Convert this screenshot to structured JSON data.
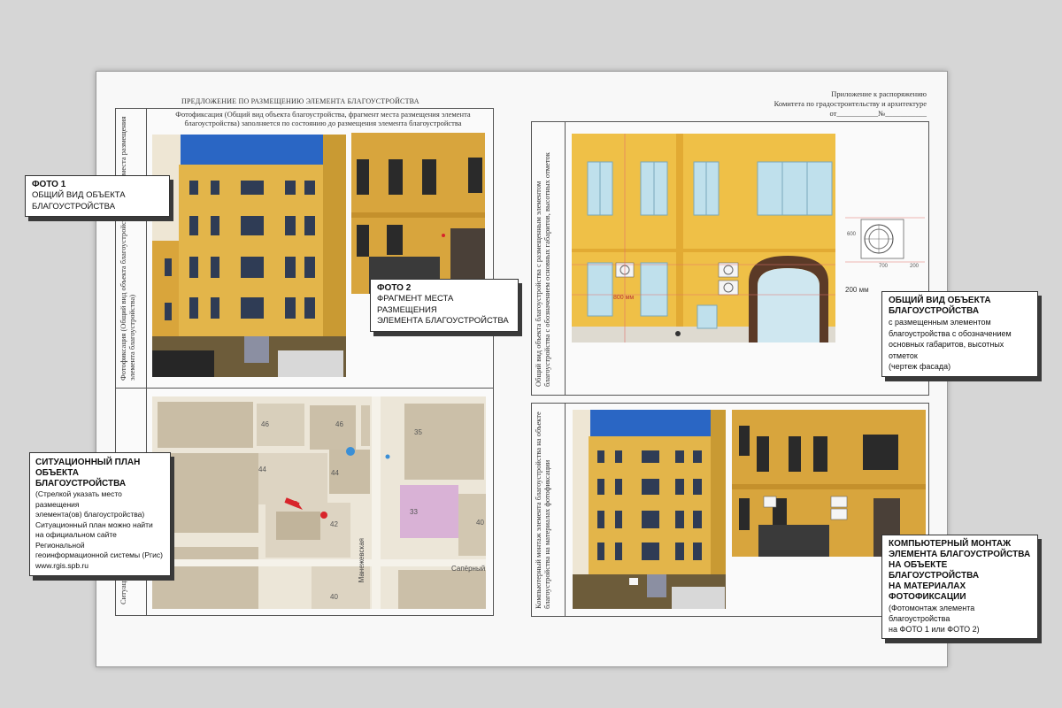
{
  "header": {
    "title": "ПРЕДЛОЖЕНИЕ ПО РАЗМЕЩЕНИЮ ЭЛЕМЕНТА БЛАГОУСТРОЙСТВА",
    "appendix_line1": "Приложение к распоряжению",
    "appendix_line2": "Комитета по градостроительству и архитектуре",
    "appendix_line3": "от___________№___________"
  },
  "photo_panel": {
    "side_label": "Фотофиксация (Общий вид объекта благоустройства, фрагмент места размещения элемента благоустройства)",
    "caption": "Фотофиксация (Общий вид объекта благоустройства, фрагмент места размещения элемента благоустройства) заполняется по состоянию до размещения элемента благоустройства"
  },
  "plan_panel": {
    "side_label": "Ситуационный план объекта благоустройства",
    "streets": [
      "Манежевская",
      "Сапёрный"
    ],
    "house_numbers": [
      "46",
      "46",
      "44",
      "44",
      "42",
      "40",
      "35",
      "33",
      "40"
    ]
  },
  "facade_panel": {
    "side_label": "Общий вид объекта благоустройства с размещенным элементом благоустройства с обозначением основных габаритов, высотных отметок",
    "dim_200": "200 мм",
    "dim_800": "800 мм",
    "dim_700": "700",
    "dim_200b": "200",
    "dim_600": "600"
  },
  "montage_panel": {
    "side_label": "Компьютерный монтаж элемента благоустройства на объекте благоустройства на материалах фотофиксации"
  },
  "callouts": {
    "photo1": {
      "title": "ФОТО 1",
      "desc": "ОБЩИЙ ВИД ОБЪЕКТА\nБЛАГОУСТРОЙСТВА"
    },
    "photo2": {
      "title": "ФОТО 2",
      "desc": "ФРАГМЕНТ МЕСТА РАЗМЕЩЕНИЯ\nЭЛЕМЕНТА БЛАГОУСТРОЙСТВА"
    },
    "plan": {
      "title": "СИТУАЦИОННЫЙ ПЛАН ОБЪЕКТА\nБЛАГОУСТРОЙСТВА",
      "desc": "(Стрелкой указать место размещения\nэлемента(ов) благоустройства)\nСитуационный план можно найти\nна официальном сайте Региональной\nгеоинформационной системы (Ргис)\nwww.rgis.spb.ru"
    },
    "facade": {
      "title": "ОБЩИЙ ВИД ОБЪЕКТА\nБЛАГОУСТРОЙСТВА",
      "desc": "с размещенным элементом\nблагоустройства с обозначением\nосновных габаритов, высотных отметок\n(чертеж фасада)"
    },
    "montage": {
      "title": "КОМПЬЮТЕРНЫЙ МОНТАЖ\nЭЛЕМЕНТА БЛАГОУСТРОЙСТВА\nНА ОБЪЕКТЕ БЛАГОУСТРОЙСТВА\nНА МАТЕРИАЛАХ ФОТОФИКСАЦИИ",
      "desc": "(Фотомонтаж элемента благоустройства\nна ФОТО 1 или ФОТО 2)"
    }
  },
  "colors": {
    "facade_yellow": "#efc047",
    "building_yellow": "#e1b248",
    "sky_blue": "#2e6dc7",
    "map_purple": "#d9b2d6",
    "arrow_red": "#d8242a"
  }
}
